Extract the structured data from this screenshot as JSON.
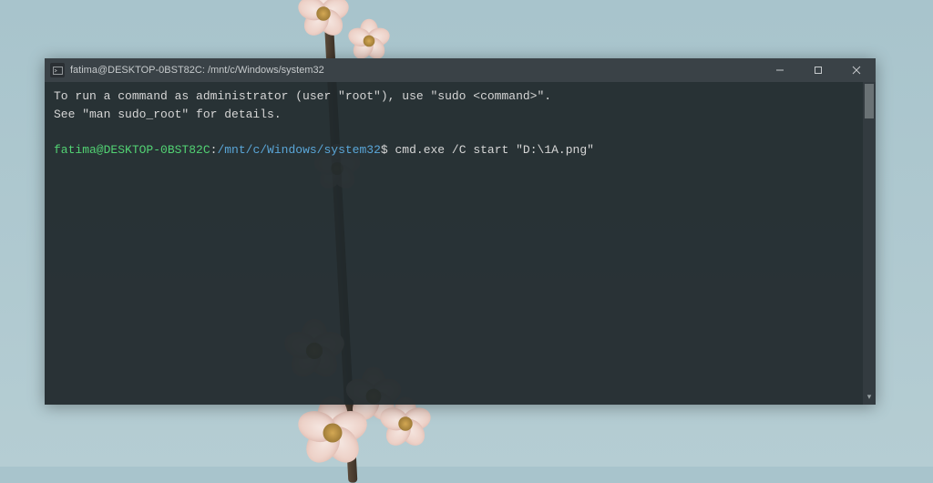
{
  "titlebar": {
    "icon_name": "terminal-icon",
    "title": "fatima@DESKTOP-0BST82C: /mnt/c/Windows/system32"
  },
  "window_controls": {
    "minimize": "minimize",
    "maximize": "maximize",
    "close": "close"
  },
  "terminal": {
    "message_line1": "To run a command as administrator (user \"root\"), use \"sudo <command>\".",
    "message_line2": "See \"man sudo_root\" for details.",
    "prompt": {
      "user_host": "fatima@DESKTOP-0BST82C",
      "separator": ":",
      "path": "/mnt/c/Windows/system32",
      "symbol": "$"
    },
    "command": " cmd.exe /C start \"D:\\1A.png\""
  },
  "colors": {
    "prompt_user": "#52d273",
    "prompt_path": "#5aa6d8",
    "terminal_bg": "#20282c",
    "titlebar_bg": "#3a4247"
  }
}
